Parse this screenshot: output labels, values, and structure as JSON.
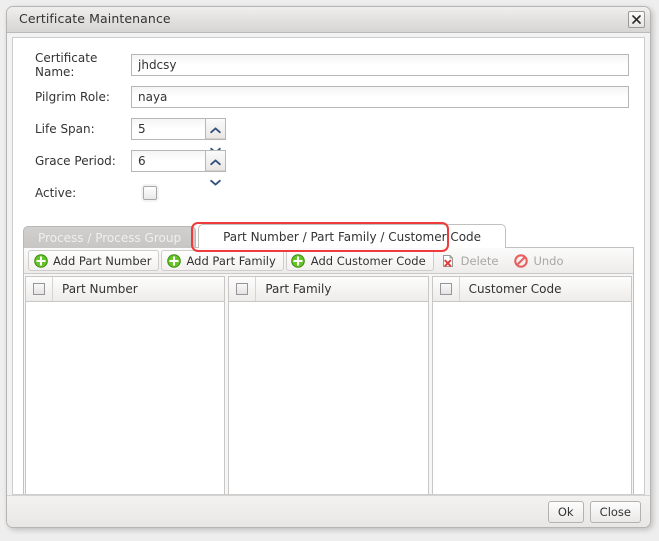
{
  "window": {
    "title": "Certificate Maintenance",
    "close_icon": "close-x-icon"
  },
  "form": {
    "fields": [
      {
        "label": "Certificate Name:",
        "value": "jhdcsy",
        "placeholder": "",
        "type": "text"
      },
      {
        "label": "Pilgrim Role:",
        "value": "naya",
        "placeholder": "",
        "type": "text"
      },
      {
        "label": "Life Span:",
        "value": "5",
        "placeholder": "",
        "type": "spinner"
      },
      {
        "label": "Grace Period:",
        "value": "6",
        "placeholder": "",
        "type": "spinner"
      },
      {
        "label": "Active:",
        "value": "",
        "placeholder": "",
        "type": "checkbox",
        "checked": false
      }
    ]
  },
  "tabs": [
    {
      "label": "Process / Process Group",
      "active": false
    },
    {
      "label": "Part Number / Part Family / Customer Code",
      "active": true
    }
  ],
  "highlight": {
    "color": "#ef3b3b",
    "target": "Part Number / Part Family / Customer Code"
  },
  "toolbar": {
    "buttons": [
      {
        "label": "Add Part Number",
        "icon": "add-plus-icon",
        "enabled": true
      },
      {
        "label": "Add Part Family",
        "icon": "add-plus-icon",
        "enabled": true
      },
      {
        "label": "Add Customer Code",
        "icon": "add-plus-icon",
        "enabled": true
      },
      {
        "label": "Delete",
        "icon": "delete-document-icon",
        "enabled": false
      },
      {
        "label": "Undo",
        "icon": "undo-forbidden-icon",
        "enabled": false
      }
    ]
  },
  "grids": [
    {
      "header": "Part Number",
      "rows": []
    },
    {
      "header": "Part Family",
      "rows": []
    },
    {
      "header": "Customer Code",
      "rows": []
    }
  ],
  "footer": {
    "ok_label": "Ok",
    "close_label": "Close"
  },
  "colors": {
    "accent_red": "#ef3b3b",
    "add_green": "#63c423",
    "titlebar": "#e3e1df",
    "dialog_bg": "#f2f2f2",
    "page_bg": "#eeeeee"
  }
}
